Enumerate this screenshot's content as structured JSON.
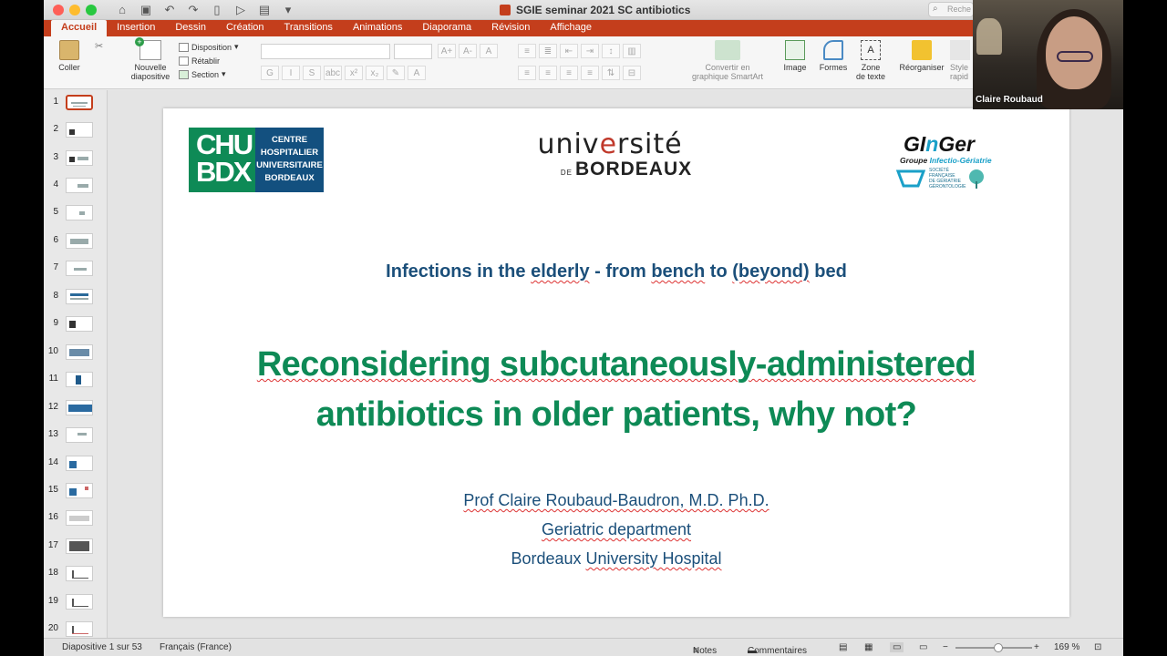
{
  "window": {
    "title": "SGIE seminar 2021 SC antibiotics",
    "search_placeholder": "Reche"
  },
  "tabs": [
    "Accueil",
    "Insertion",
    "Dessin",
    "Création",
    "Transitions",
    "Animations",
    "Diaporama",
    "Révision",
    "Affichage"
  ],
  "ribbon": {
    "paste_label": "Coller",
    "new_slide_label": "Nouvelle\ndiapositive",
    "layout_label": "Disposition",
    "reset_label": "Rétablir",
    "section_label": "Section",
    "smartart_label": "Convertir en\ngraphique SmartArt",
    "image_label": "Image",
    "shapes_label": "Formes",
    "textbox_label": "Zone\nde texte",
    "arrange_label": "Réorganiser",
    "styles_label": "Style\nrapid"
  },
  "thumbnails": [
    "1",
    "2",
    "3",
    "4",
    "5",
    "6",
    "7",
    "8",
    "9",
    "10",
    "11",
    "12",
    "13",
    "14",
    "15",
    "16",
    "17",
    "18",
    "19",
    "20"
  ],
  "slide": {
    "logo_chu_left": "CHU\nBDX",
    "logo_chu_right": "CENTRE\nHOSPITALIER\nUNIVERSITAIRE\nBORDEAUX",
    "logo_ubx_top_a": "univ",
    "logo_ubx_top_b": "e",
    "logo_ubx_top_c": "rsité",
    "logo_ubx_de": "DE",
    "logo_ubx_bottom": "BORDEAUX",
    "logo_ginger_a": "GI",
    "logo_ginger_b": "n",
    "logo_ginger_c": "Ger",
    "logo_ginger_sub_a": "Groupe ",
    "logo_ginger_sub_b": "Infectio-Gériatrie",
    "logo_sfgg": "SOCIÉTÉ FRANÇAISE DE GÉRIATRIE GÉRONTOLOGIE",
    "subtitle_pre": "Infections in the ",
    "subtitle_elderly": "elderly",
    "subtitle_mid": " - from ",
    "subtitle_bench": "bench",
    "subtitle_to": " to ",
    "subtitle_beyond": "(beyond)",
    "subtitle_end": " bed",
    "title_line1": "Reconsidering subcutaneously-administered",
    "title_line2": "antibiotics in older patients, why not?",
    "author_name": "Prof Claire Roubaud-Baudron, M.D. Ph.D.",
    "author_dept": "Geriatric department",
    "author_inst_a": "Bordeaux ",
    "author_inst_b": "University Hospital"
  },
  "status": {
    "slide_counter": "Diapositive 1 sur 53",
    "language": "Français (France)",
    "notes_label": "Notes",
    "comments_label": "Commentaires",
    "zoom": "169 %"
  },
  "webcam": {
    "participant": "Claire Roubaud"
  }
}
